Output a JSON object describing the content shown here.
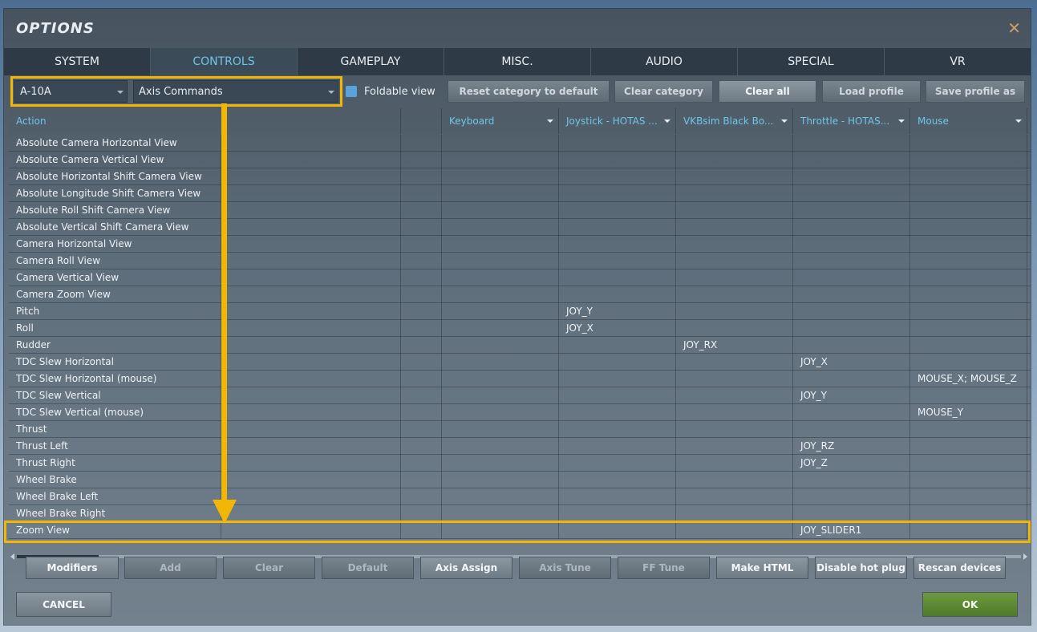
{
  "window": {
    "title": "OPTIONS",
    "close_glyph": "✕"
  },
  "tabs": [
    {
      "label": "SYSTEM",
      "active": false
    },
    {
      "label": "CONTROLS",
      "active": true
    },
    {
      "label": "GAMEPLAY",
      "active": false
    },
    {
      "label": "MISC.",
      "active": false
    },
    {
      "label": "AUDIO",
      "active": false
    },
    {
      "label": "SPECIAL",
      "active": false
    },
    {
      "label": "VR",
      "active": false
    }
  ],
  "toolbar": {
    "aircraft_select": "A-10A",
    "category_select": "Axis Commands",
    "foldable_label": "Foldable view",
    "reset_category": "Reset category to default",
    "clear_category": "Clear category",
    "clear_all": "Clear all",
    "load_profile": "Load profile",
    "save_profile": "Save profile as"
  },
  "table": {
    "headers": [
      "Action",
      "",
      "Keyboard",
      "Joystick - HOTAS ...",
      "VKBsim Black Bo...",
      "Throttle - HOTAS...",
      "Mouse"
    ],
    "rows": [
      [
        "Absolute Camera Horizontal View",
        "",
        "",
        "",
        "",
        "",
        ""
      ],
      [
        "Absolute Camera Vertical View",
        "",
        "",
        "",
        "",
        "",
        ""
      ],
      [
        "Absolute Horizontal Shift Camera View",
        "",
        "",
        "",
        "",
        "",
        ""
      ],
      [
        "Absolute Longitude Shift Camera View",
        "",
        "",
        "",
        "",
        "",
        ""
      ],
      [
        "Absolute Roll Shift Camera View",
        "",
        "",
        "",
        "",
        "",
        ""
      ],
      [
        "Absolute Vertical Shift Camera View",
        "",
        "",
        "",
        "",
        "",
        ""
      ],
      [
        "Camera Horizontal View",
        "",
        "",
        "",
        "",
        "",
        ""
      ],
      [
        "Camera Roll View",
        "",
        "",
        "",
        "",
        "",
        ""
      ],
      [
        "Camera Vertical View",
        "",
        "",
        "",
        "",
        "",
        ""
      ],
      [
        "Camera Zoom View",
        "",
        "",
        "",
        "",
        "",
        ""
      ],
      [
        "Pitch",
        "",
        "",
        "JOY_Y",
        "",
        "",
        ""
      ],
      [
        "Roll",
        "",
        "",
        "JOY_X",
        "",
        "",
        ""
      ],
      [
        "Rudder",
        "",
        "",
        "",
        "JOY_RX",
        "",
        ""
      ],
      [
        "TDC Slew Horizontal",
        "",
        "",
        "",
        "",
        "JOY_X",
        ""
      ],
      [
        "TDC Slew Horizontal (mouse)",
        "",
        "",
        "",
        "",
        "",
        "MOUSE_X; MOUSE_Z"
      ],
      [
        "TDC Slew Vertical",
        "",
        "",
        "",
        "",
        "JOY_Y",
        ""
      ],
      [
        "TDC Slew Vertical (mouse)",
        "",
        "",
        "",
        "",
        "",
        "MOUSE_Y"
      ],
      [
        "Thrust",
        "",
        "",
        "",
        "",
        "",
        ""
      ],
      [
        "Thrust Left",
        "",
        "",
        "",
        "",
        "JOY_RZ",
        ""
      ],
      [
        "Thrust Right",
        "",
        "",
        "",
        "",
        "JOY_Z",
        ""
      ],
      [
        "Wheel Brake",
        "",
        "",
        "",
        "",
        "",
        ""
      ],
      [
        "Wheel Brake Left",
        "",
        "",
        "",
        "",
        "",
        ""
      ],
      [
        "Wheel Brake Right",
        "",
        "",
        "",
        "",
        "",
        ""
      ],
      [
        "Zoom View",
        "",
        "",
        "",
        "",
        "JOY_SLIDER1",
        ""
      ]
    ]
  },
  "actions": {
    "modifiers": "Modifiers",
    "add": "Add",
    "clear": "Clear",
    "default": "Default",
    "axis_assign": "Axis Assign",
    "axis_tune": "Axis Tune",
    "ff_tune": "FF Tune",
    "make_html": "Make HTML",
    "disable_hot_plug": "Disable hot plug",
    "rescan_devices": "Rescan devices"
  },
  "footer": {
    "cancel": "CANCEL",
    "ok": "OK"
  },
  "colors": {
    "highlight": "#f2b705",
    "accent": "#6ec6e8",
    "ok_green": "#5f8a33"
  }
}
